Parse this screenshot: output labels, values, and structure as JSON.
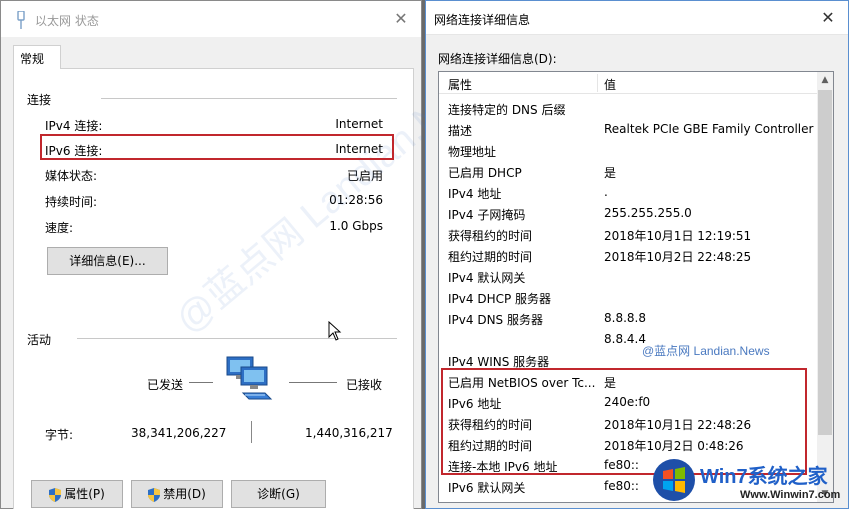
{
  "left_window": {
    "title": "以太网 状态",
    "tab": "常规",
    "connection_group": "连接",
    "rows": [
      {
        "label": "IPv4 连接:",
        "value": "Internet"
      },
      {
        "label": "IPv6 连接:",
        "value": "Internet"
      },
      {
        "label": "媒体状态:",
        "value": "已启用"
      },
      {
        "label": "持续时间:",
        "value": "01:28:56"
      },
      {
        "label": "速度:",
        "value": "1.0 Gbps"
      }
    ],
    "details_button": "详细信息(E)...",
    "activity_group": "活动",
    "sent_label": "已发送",
    "received_label": "已接收",
    "bytes_label": "字节:",
    "bytes_sent": "38,341,206,227",
    "bytes_received": "1,440,316,217",
    "buttons": {
      "properties": "属性(P)",
      "disable": "禁用(D)",
      "diagnose": "诊断(G)"
    },
    "watermark": "@蓝点网 Landian.News"
  },
  "right_window": {
    "title": "网络连接详细信息",
    "list_caption": "网络连接详细信息(D):",
    "col_property": "属性",
    "col_value": "值",
    "rows": [
      {
        "p": "连接特定的 DNS 后缀",
        "v": ""
      },
      {
        "p": "描述",
        "v": "Realtek PCIe GBE Family Controller"
      },
      {
        "p": "物理地址",
        "v": ""
      },
      {
        "p": "已启用 DHCP",
        "v": "是"
      },
      {
        "p": "IPv4 地址",
        "v": "."
      },
      {
        "p": "IPv4 子网掩码",
        "v": "255.255.255.0"
      },
      {
        "p": "获得租约的时间",
        "v": "2018年10月1日 12:19:51"
      },
      {
        "p": "租约过期的时间",
        "v": "2018年10月2日 22:48:25"
      },
      {
        "p": "IPv4 默认网关",
        "v": ""
      },
      {
        "p": "IPv4 DHCP 服务器",
        "v": ""
      },
      {
        "p": "IPv4 DNS 服务器",
        "v": "8.8.8.8"
      },
      {
        "p": "",
        "v": "8.8.4.4"
      },
      {
        "p": "IPv4 WINS 服务器",
        "v": ""
      },
      {
        "p": "已启用 NetBIOS over Tc...",
        "v": "是"
      },
      {
        "p": "IPv6 地址",
        "v": "240e:f0"
      },
      {
        "p": "获得租约的时间",
        "v": "2018年10月1日 22:48:26"
      },
      {
        "p": "租约过期的时间",
        "v": "2018年10月2日 0:48:26"
      },
      {
        "p": "连接-本地 IPv6 地址",
        "v": "fe80::"
      },
      {
        "p": "IPv6 默认网关",
        "v": "fe80::"
      }
    ],
    "credit": "@蓝点网 Landian.News"
  },
  "brand": {
    "name": "Win7系统之家",
    "url": "Www.Winwin7.com"
  },
  "colors": {
    "highlight": "#c1272d",
    "accent": "#5a8fd0"
  }
}
